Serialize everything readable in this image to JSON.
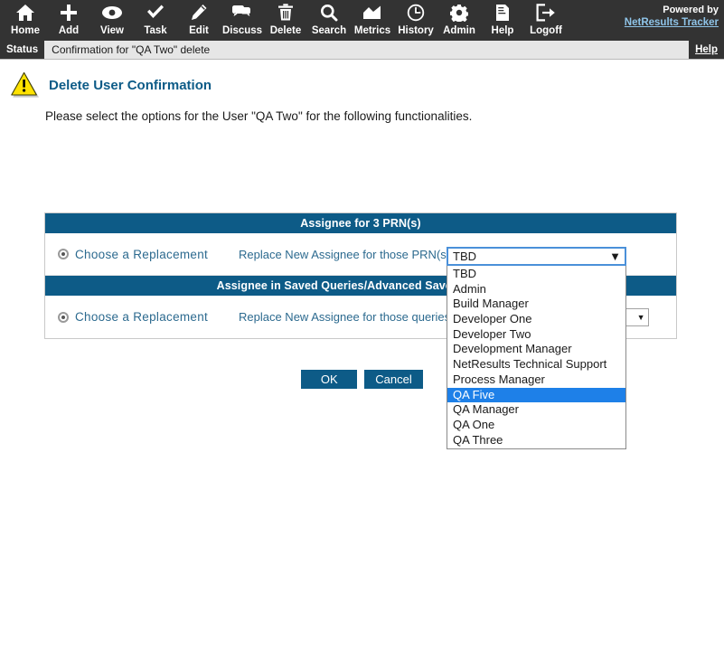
{
  "toolbar": {
    "items": [
      {
        "label": "Home",
        "icon": "home-icon"
      },
      {
        "label": "Add",
        "icon": "plus-icon"
      },
      {
        "label": "View",
        "icon": "eye-icon"
      },
      {
        "label": "Task",
        "icon": "check-icon"
      },
      {
        "label": "Edit",
        "icon": "pencil-icon"
      },
      {
        "label": "Discuss",
        "icon": "speech-bubbles-icon"
      },
      {
        "label": "Delete",
        "icon": "trash-icon"
      },
      {
        "label": "Search",
        "icon": "magnifier-icon"
      },
      {
        "label": "Metrics",
        "icon": "chart-icon"
      },
      {
        "label": "History",
        "icon": "clock-icon"
      },
      {
        "label": "Admin",
        "icon": "gear-icon"
      },
      {
        "label": "Help",
        "icon": "book-icon"
      },
      {
        "label": "Logoff",
        "icon": "exit-icon"
      }
    ],
    "powered_by": "Powered by",
    "product_link": "NetResults Tracker"
  },
  "status_bar": {
    "tag": "Status",
    "message": "Confirmation for \"QA Two\" delete",
    "help": "Help"
  },
  "page": {
    "title": "Delete User Confirmation",
    "subtitle": "Please select the options for the User \"QA Two\" for the following functionalities."
  },
  "sections": [
    {
      "header": "Assignee for 3 PRN(s)",
      "radio_label": "Choose a Replacement",
      "field_label": "Replace New Assignee for those PRN(s) by",
      "selected_value": "TBD",
      "radio_checked": true
    },
    {
      "header": "Assignee in Saved Queries/Advanced Saved Queries",
      "radio_label": "Choose a Replacement",
      "field_label": "Replace New Assignee for those queries by",
      "selected_value": "TBD",
      "radio_checked": true
    }
  ],
  "dropdown": {
    "open": true,
    "display_value": "TBD",
    "highlighted": "QA Five",
    "options": [
      "TBD",
      "Admin",
      "Build Manager",
      "Developer One",
      "Developer Two",
      "Development Manager",
      "NetResults Technical Support",
      "Process Manager",
      "QA Five",
      "QA Manager",
      "QA One",
      "QA Three"
    ]
  },
  "buttons": {
    "ok": "OK",
    "cancel": "Cancel"
  },
  "colors": {
    "toolbar_bg": "#333333",
    "header_blue": "#0d5b87",
    "link_blue": "#8fc4e8",
    "highlight_blue": "#1e80e8",
    "warning_yellow": "#ffe200"
  }
}
